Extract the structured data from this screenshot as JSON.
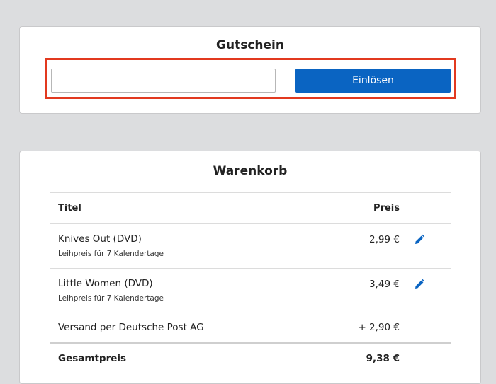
{
  "voucher": {
    "title": "Gutschein",
    "input_value": "",
    "input_placeholder": "",
    "button_label": "Einlösen"
  },
  "cart": {
    "title": "Warenkorb",
    "columns": {
      "title": "Titel",
      "price": "Preis"
    },
    "items": [
      {
        "name": "Knives Out (DVD)",
        "subtitle": "Leihpreis für 7 Kalendertage",
        "price": "2,99 €"
      },
      {
        "name": "Little Women (DVD)",
        "subtitle": "Leihpreis für 7 Kalendertage",
        "price": "3,49 €"
      }
    ],
    "shipping": {
      "label": "Versand per Deutsche Post AG",
      "price": "+ 2,90 €"
    },
    "total": {
      "label": "Gesamtpreis",
      "price": "9,38 €"
    }
  },
  "colors": {
    "accent": "#0a64c2",
    "highlight": "#e2391f",
    "background": "#dcdddf"
  },
  "icons": {
    "edit": "pencil-icon"
  }
}
